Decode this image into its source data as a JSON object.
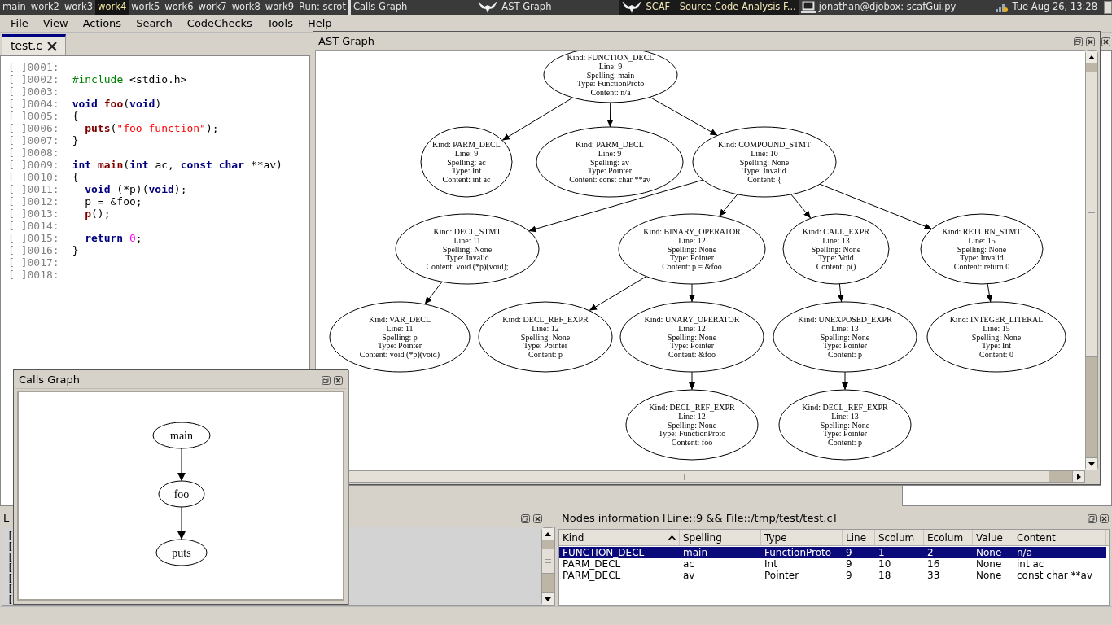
{
  "taskbar": {
    "workspaces": [
      {
        "label": "main",
        "selected": false
      },
      {
        "label": "work2",
        "selected": false
      },
      {
        "label": "work3",
        "selected": false
      },
      {
        "label": "work4",
        "selected": true
      },
      {
        "label": "work5",
        "selected": false
      },
      {
        "label": "work6",
        "selected": false
      },
      {
        "label": "work7",
        "selected": false
      },
      {
        "label": "work8",
        "selected": false
      },
      {
        "label": "work9",
        "selected": false
      }
    ],
    "run_prompt": "Run: scrot",
    "tasks": [
      {
        "label": "Calls Graph",
        "kind": "plain",
        "selected": false
      },
      {
        "label": "AST Graph",
        "kind": "app",
        "selected": false
      },
      {
        "label": "SCAF - Source Code Analysis F...",
        "kind": "app",
        "selected": true
      },
      {
        "label": "jonathan@djobox: scafGui.py",
        "kind": "terminal",
        "selected": false
      }
    ],
    "clock": "Tue Aug 26, 13:28"
  },
  "menu": [
    "File",
    "View",
    "Actions",
    "Search",
    "CodeChecks",
    "Tools",
    "Help"
  ],
  "editor": {
    "tab": "test.c",
    "lines": [
      {
        "number": "[ ]0001:"
      },
      {
        "number": "[ ]0002:",
        "indent": false,
        "tokens": [
          {
            "text": "#include",
            "kind": "pre"
          },
          {
            "text": " <stdio.h>",
            "kind": "plain"
          }
        ]
      },
      {
        "number": "[ ]0003:"
      },
      {
        "number": "[ ]0004:",
        "indent": false,
        "tokens": [
          {
            "text": "void ",
            "kind": "kw"
          },
          {
            "text": "foo",
            "kind": "fn"
          },
          {
            "text": "(",
            "kind": "plain"
          },
          {
            "text": "void",
            "kind": "kw"
          },
          {
            "text": ")",
            "kind": "plain"
          }
        ]
      },
      {
        "number": "[ ]0005:",
        "indent": false,
        "tokens": [
          {
            "text": "{",
            "kind": "plain"
          }
        ]
      },
      {
        "number": "[ ]0006:",
        "indent": true,
        "tokens": [
          {
            "text": "puts",
            "kind": "fn"
          },
          {
            "text": "(",
            "kind": "plain"
          },
          {
            "text": "\"foo function\"",
            "kind": "str"
          },
          {
            "text": ");",
            "kind": "plain"
          }
        ]
      },
      {
        "number": "[ ]0007:",
        "indent": false,
        "tokens": [
          {
            "text": "}",
            "kind": "plain"
          }
        ]
      },
      {
        "number": "[ ]0008:"
      },
      {
        "number": "[ ]0009:",
        "indent": false,
        "tokens": [
          {
            "text": "int ",
            "kind": "kw"
          },
          {
            "text": "main",
            "kind": "fn"
          },
          {
            "text": "(",
            "kind": "plain"
          },
          {
            "text": "int",
            "kind": "kw"
          },
          {
            "text": " ac, ",
            "kind": "plain"
          },
          {
            "text": "const char",
            "kind": "kw"
          },
          {
            "text": " **av)",
            "kind": "plain"
          }
        ]
      },
      {
        "number": "[ ]0010:",
        "indent": false,
        "tokens": [
          {
            "text": "{",
            "kind": "plain"
          }
        ]
      },
      {
        "number": "[ ]0011:",
        "indent": true,
        "tokens": [
          {
            "text": "void",
            "kind": "kw"
          },
          {
            "text": " (*p)(",
            "kind": "plain"
          },
          {
            "text": "void",
            "kind": "kw"
          },
          {
            "text": ");",
            "kind": "plain"
          }
        ]
      },
      {
        "number": "[ ]0012:",
        "indent": true,
        "tokens": [
          {
            "text": "p = &foo;",
            "kind": "plain"
          }
        ]
      },
      {
        "number": "[ ]0013:",
        "indent": true,
        "tokens": [
          {
            "text": "p",
            "kind": "fn"
          },
          {
            "text": "();",
            "kind": "plain"
          }
        ]
      },
      {
        "number": "[ ]0014:"
      },
      {
        "number": "[ ]0015:",
        "indent": true,
        "tokens": [
          {
            "text": "return ",
            "kind": "kw"
          },
          {
            "text": "0",
            "kind": "num"
          },
          {
            "text": ";",
            "kind": "plain"
          }
        ]
      },
      {
        "number": "[ ]0016:",
        "indent": false,
        "tokens": [
          {
            "text": "}",
            "kind": "plain"
          }
        ]
      },
      {
        "number": "[ ]0017:"
      },
      {
        "number": "[ ]0018:"
      }
    ]
  },
  "log": {
    "title": "L",
    "lines": [
      "[",
      "[",
      "[",
      "[",
      "[",
      "[",
      "["
    ]
  },
  "nodes_info": {
    "title": "Nodes information [Line::9 && File::/tmp/test/test.c]",
    "columns": [
      {
        "label": "Kind",
        "sorted": true
      },
      {
        "label": "Spelling",
        "sorted": false
      },
      {
        "label": "Type",
        "sorted": false
      },
      {
        "label": "Line",
        "sorted": false
      },
      {
        "label": "Scolum",
        "sorted": false
      },
      {
        "label": "Ecolum",
        "sorted": false
      },
      {
        "label": "Value",
        "sorted": false
      },
      {
        "label": "Content",
        "sorted": false
      }
    ],
    "rows": [
      {
        "selected": true,
        "cells": [
          "FUNCTION_DECL",
          "main",
          "FunctionProto",
          "9",
          "1",
          "2",
          "None",
          "n/a"
        ]
      },
      {
        "selected": false,
        "cells": [
          "PARM_DECL",
          "ac",
          "Int",
          "9",
          "10",
          "16",
          "None",
          "int ac"
        ]
      },
      {
        "selected": false,
        "cells": [
          "PARM_DECL",
          "av",
          "Pointer",
          "9",
          "18",
          "33",
          "None",
          "const char **av"
        ]
      }
    ]
  },
  "ast_window": {
    "title": "AST Graph",
    "tree": {
      "lines": [
        "Kind: FUNCTION_DECL",
        "Line: 9",
        "Spelling: main",
        "Type: FunctionProto",
        "Content: n/a"
      ],
      "children": [
        {
          "lines": [
            "Kind: PARM_DECL",
            "Line: 9",
            "Spelling: ac",
            "Type: Int",
            "Content: int ac"
          ]
        },
        {
          "lines": [
            "Kind: PARM_DECL",
            "Line: 9",
            "Spelling: av",
            "Type: Pointer",
            "Content: const char **av"
          ]
        },
        {
          "lines": [
            "Kind: COMPOUND_STMT",
            "Line: 10",
            "Spelling: None",
            "Type: Invalid",
            "Content: {"
          ],
          "children": [
            {
              "lines": [
                "Kind: DECL_STMT",
                "Line: 11",
                "Spelling: None",
                "Type: Invalid",
                "Content: void (*p)(void);"
              ],
              "children": [
                {
                  "lines": [
                    "Kind: VAR_DECL",
                    "Line: 11",
                    "Spelling: p",
                    "Type: Pointer",
                    "Content: void (*p)(void)"
                  ]
                }
              ]
            },
            {
              "lines": [
                "Kind: BINARY_OPERATOR",
                "Line: 12",
                "Spelling: None",
                "Type: Pointer",
                "Content: p = &foo"
              ],
              "children": [
                {
                  "lines": [
                    "Kind: DECL_REF_EXPR",
                    "Line: 12",
                    "Spelling: None",
                    "Type: Pointer",
                    "Content: p"
                  ]
                },
                {
                  "lines": [
                    "Kind: UNARY_OPERATOR",
                    "Line: 12",
                    "Spelling: None",
                    "Type: Pointer",
                    "Content: &foo"
                  ],
                  "children": [
                    {
                      "lines": [
                        "Kind: DECL_REF_EXPR",
                        "Line: 12",
                        "Spelling: None",
                        "Type: FunctionProto",
                        "Content: foo"
                      ]
                    }
                  ]
                }
              ]
            },
            {
              "lines": [
                "Kind: CALL_EXPR",
                "Line: 13",
                "Spelling: None",
                "Type: Void",
                "Content: p()"
              ],
              "children": [
                {
                  "lines": [
                    "Kind: UNEXPOSED_EXPR",
                    "Line: 13",
                    "Spelling: None",
                    "Type: Pointer",
                    "Content: p"
                  ],
                  "children": [
                    {
                      "lines": [
                        "Kind: DECL_REF_EXPR",
                        "Line: 13",
                        "Spelling: None",
                        "Type: Pointer",
                        "Content: p"
                      ]
                    }
                  ]
                }
              ]
            },
            {
              "lines": [
                "Kind: RETURN_STMT",
                "Line: 15",
                "Spelling: None",
                "Type: Invalid",
                "Content: return 0"
              ],
              "children": [
                {
                  "lines": [
                    "Kind: INTEGER_LITERAL",
                    "Line: 15",
                    "Spelling: None",
                    "Type: Int",
                    "Content: 0"
                  ]
                }
              ]
            }
          ]
        }
      ]
    }
  },
  "calls_window": {
    "title": "Calls Graph",
    "tree": {
      "label": "main",
      "children": [
        {
          "label": "foo",
          "children": [
            {
              "label": "puts"
            }
          ]
        }
      ]
    }
  }
}
